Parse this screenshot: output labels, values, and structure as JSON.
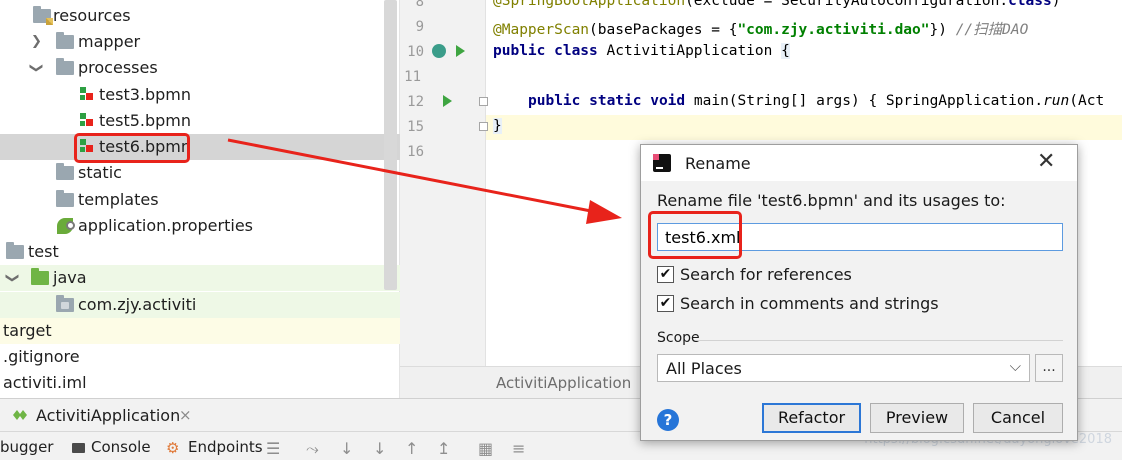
{
  "tree": {
    "items": [
      {
        "label": "resources"
      },
      {
        "label": "mapper"
      },
      {
        "label": "processes"
      },
      {
        "label": "test3.bpmn"
      },
      {
        "label": "test5.bpmn"
      },
      {
        "label": "test6.bpmn"
      },
      {
        "label": "static"
      },
      {
        "label": "templates"
      },
      {
        "label": "application.properties"
      },
      {
        "label": "test"
      },
      {
        "label": "java"
      },
      {
        "label": "com.zjy.activiti"
      },
      {
        "label": "target"
      },
      {
        "label": ".gitignore"
      },
      {
        "label": "activiti.iml"
      }
    ]
  },
  "editor": {
    "line_numbers": [
      "8",
      "9",
      "10",
      "11",
      "12",
      "15",
      "16"
    ],
    "tab_label": "ActivitiApplication",
    "code": {
      "l8_ann": "@SpringBootApplication",
      "l8_rest": "(exclude = SecurityAutoConfiguration.",
      "l8_kw": "class",
      "l8_end": ")",
      "l9_ann": "@MapperScan",
      "l9_a": "(basePackages = {",
      "l9_str": "\"com.zjy.activiti.dao\"",
      "l9_b": "}) ",
      "l9_cmt": "//扫描DAO",
      "l10_kw": "public class ",
      "l10_name": "ActivitiApplication ",
      "l10_brace": "{",
      "l12_kw": "public static void ",
      "l12_a": "main(String[] args) { SpringApplication.",
      "l12_it": "run",
      "l12_b": "(Act",
      "l15": "}"
    }
  },
  "run_panel": {
    "title": "ActivitiApplication",
    "close": "×",
    "toolbar": {
      "debugger": "bugger",
      "console": "Console",
      "endpoints": "Endpoints"
    }
  },
  "dialog": {
    "title": "Rename",
    "close": "✕",
    "message": "Rename file 'test6.bpmn' and its usages to:",
    "input_value": "test6.xml",
    "search_references": "Search for references",
    "search_comments": "Search in comments and strings",
    "search_references_checked": true,
    "search_comments_checked": true,
    "scope_label": "Scope",
    "scope_value": "All Places",
    "dots": "...",
    "help": "?",
    "refactor": "Refactor",
    "preview": "Preview",
    "cancel": "Cancel"
  },
  "watermark": "https://blog.csdn.net/dayonglove2018",
  "colors": {
    "highlight_red": "#e8231b",
    "selection": "#d5d5d5",
    "accent_blue": "#2c77d6"
  }
}
